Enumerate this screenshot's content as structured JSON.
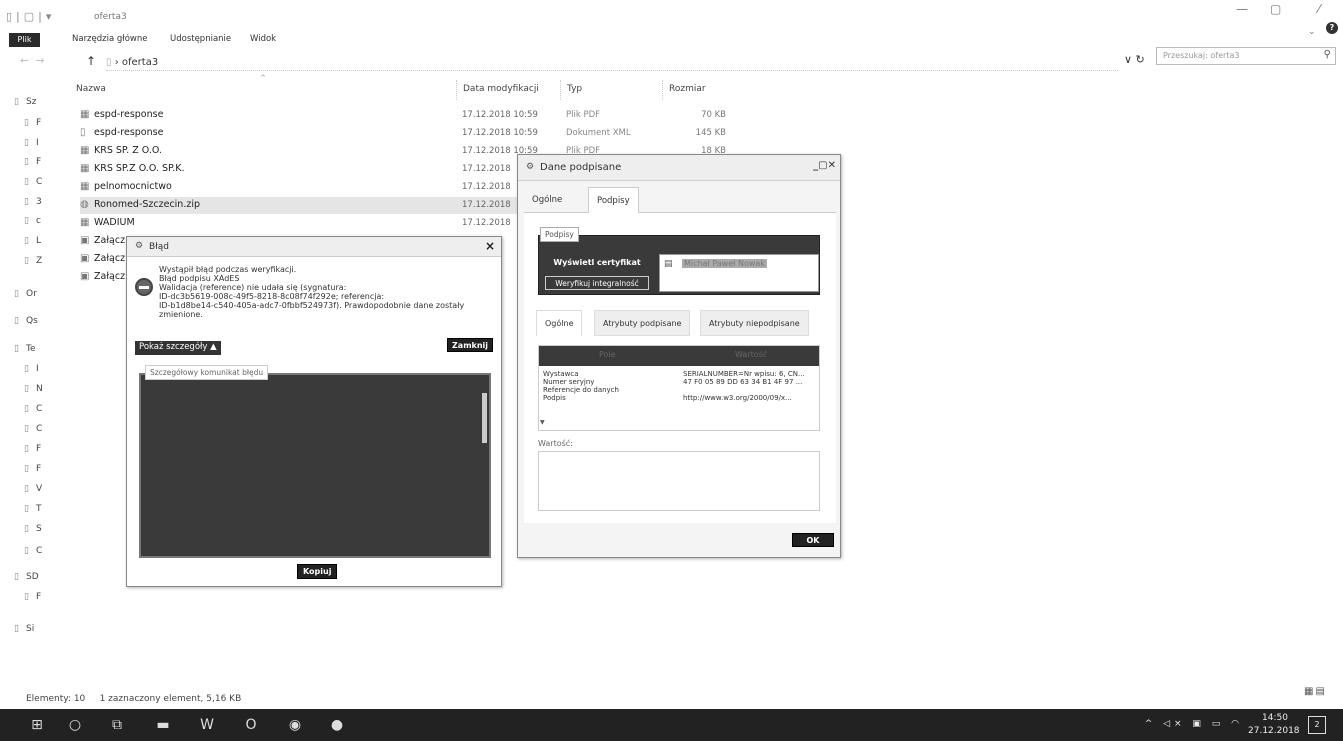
{
  "window": {
    "title": "oferta3",
    "controls": [
      "—",
      "▢",
      "✕"
    ]
  },
  "ribbon": {
    "file_tab": "Plik",
    "tabs": [
      "Narzędzia główne",
      "Udostępnianie",
      "Widok"
    ]
  },
  "address": {
    "path": "oferta3",
    "search_placeholder": "Przeszukaj: oferta3"
  },
  "columns": {
    "name": "Nazwa",
    "date": "Data modyfikacji",
    "type": "Typ",
    "size": "Rozmiar"
  },
  "sidebar": {
    "items": [
      "Sz",
      "F",
      "I",
      "F",
      "C",
      "3",
      "c",
      "L",
      "Z",
      "Or",
      "Qs",
      "Te",
      "I",
      "N",
      "C",
      "C",
      "F",
      "F",
      "V",
      "T",
      "S",
      "C",
      "SD",
      "F",
      "Si"
    ]
  },
  "files": [
    {
      "name": "espd-response",
      "date": "17.12.2018 10:59",
      "type": "Plik PDF",
      "size": "70 KB",
      "icon": "pdf-file-icon"
    },
    {
      "name": "espd-response",
      "date": "17.12.2018 10:59",
      "type": "Dokument XML",
      "size": "145 KB",
      "icon": "xml-file-icon"
    },
    {
      "name": "KRS SP. Z O.O.",
      "date": "17.12.2018 10:59",
      "type": "Plik PDF",
      "size": "18 KB",
      "icon": "pdf-file-icon"
    },
    {
      "name": "KRS SP.Z O.O. SP.K.",
      "date": "17.12.2018",
      "type": "",
      "size": "",
      "icon": "pdf-file-icon"
    },
    {
      "name": "pelnomocnictwo",
      "date": "17.12.2018",
      "type": "",
      "size": "",
      "icon": "pdf-file-icon"
    },
    {
      "name": "Ronomed-Szczecin.zip",
      "date": "17.12.2018",
      "type": "",
      "size": "",
      "icon": "signed-zip-icon"
    },
    {
      "name": "WADIUM",
      "date": "17.12.2018",
      "type": "",
      "size": "",
      "icon": "pdf-file-icon"
    },
    {
      "name": "Załącz",
      "date": "",
      "type": "",
      "size": "",
      "icon": "word-file-icon"
    },
    {
      "name": "Załącz",
      "date": "",
      "type": "",
      "size": "",
      "icon": "word-file-icon"
    },
    {
      "name": "Załącz",
      "date": "",
      "type": "",
      "size": "",
      "icon": "word-file-icon"
    }
  ],
  "error_dialog": {
    "title": "Błąd",
    "message_lines": [
      "Wystąpił błąd podczas weryfikacji.",
      "Błąd podpisu XAdES",
      "Walidacja (reference) nie udała się (sygnatura:",
      "ID-dc3b5619-008c-49f5-8218-8c08f74f292e; referencja:",
      "ID-b1d8be14-c540-405a-adc7-0fbbf524973f). Prawdopodobnie dane zostały",
      "zmienione."
    ],
    "details_button": "Pokaż szczegóły ▲",
    "close_button": "Zamknij",
    "details_label": "Szczegółowy komunikat błędu",
    "copy_button": "Kopiuj"
  },
  "signed_dialog": {
    "title": "Dane podpisane",
    "tabs": [
      "Ogólne",
      "Podpisy"
    ],
    "signatures_label": "Podpisy",
    "show_cert_button": "Wyświetl certyfikat",
    "verify_button": "Weryfikuj integralność",
    "signer": "Michał Paweł Nowak",
    "inner_tabs": [
      "Ogólne",
      "Atrybuty podpisane",
      "Atrybuty niepodpisane"
    ],
    "table_headers": [
      "Pole",
      "Wartość"
    ],
    "rows": [
      {
        "field": "Wystawca",
        "value": "SERIALNUMBER=Nr wpisu: 6, CN..."
      },
      {
        "field": "Numer seryjny",
        "value": "47 F0 05 89 DD 63 34 B1 4F 97 ..."
      },
      {
        "field": "Referencje do danych",
        "value": ""
      },
      {
        "field": "Podpis",
        "value": "http://www.w3.org/2000/09/x..."
      }
    ],
    "value_label": "Wartość:",
    "ok_button": "OK"
  },
  "statusbar": {
    "elements": "Elementy: 10",
    "selected": "1 zaznaczony element, 5,16 KB"
  },
  "taskbar": {
    "time": "14:50",
    "date": "27.12.2018"
  }
}
